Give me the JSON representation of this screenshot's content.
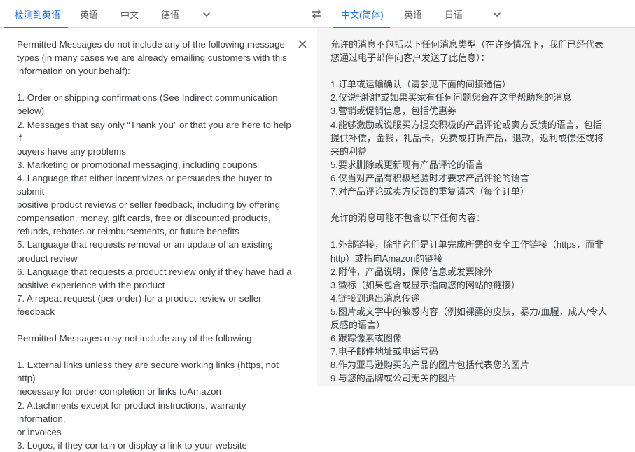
{
  "source_tabs": [
    {
      "label": "检测到英语",
      "active": true
    },
    {
      "label": "英语",
      "active": false
    },
    {
      "label": "中文",
      "active": false
    },
    {
      "label": "德语",
      "active": false
    }
  ],
  "target_tabs": [
    {
      "label": "中文(简体)",
      "active": true
    },
    {
      "label": "英语",
      "active": false
    },
    {
      "label": "日语",
      "active": false
    }
  ],
  "icons": {
    "source_more": "chevron-down-icon",
    "target_more": "chevron-down-icon",
    "swap": "swap-icon",
    "clear": "close-icon"
  },
  "colors": {
    "accent": "#1a73e8",
    "text": "#3c4043",
    "muted": "#5f6368",
    "output_bg": "#f5f5f5"
  },
  "source_text": "Permitted Messages do not include any of the following message\ntypes (in many cases we are already emailing customers with this\ninformation on your behalf):\n\n1. Order or shipping confirmations (See Indirect communication\nbelow)\n2. Messages that say only “Thank you” or that you are here to help if\nbuyers have any problems\n3. Marketing or promotional messaging, including coupons\n4. Language that either incentivizes or persuades the buyer to submit\npositive product reviews or seller feedback, including by offering\ncompensation, money, gift cards, free or discounted products,\nrefunds, rebates or reimbursements, or future benefits\n5. Language that requests removal or an update of an existing\nproduct review\n6. Language that requests a product review only if they have had a\npositive experience with the product\n7. A repeat request (per order) for a product review or seller feedback\n\nPermitted Messages may not include any of the following:\n\n1. External links unless they are secure working links (https, not http)\nnecessary for order completion or links toAmazon\n2. Attachments except for product instructions, warranty information,\nor invoices\n3. Logos, if they contain or display a link to your website",
  "translated_text": "允许的消息不包括以下任何消息类型（在许多情况下，我们已经代表\n您通过电子邮件向客户发送了此信息）：\n\n1.订单或运输确认（请参见下面的间接通信）\n2.仅说“谢谢”或如果买家有任何问题您会在这里帮助您的消息\n3.营销或促销信息，包括优惠券\n4.能够激励或说服买方提交积极的产品评论或卖方反馈的语言，包括\n提供补偿，金钱，礼品卡，免费或打折产品，退款，返利或偿还或将\n来的利益\n5.要求删除或更新现有产品评论的语言\n6.仅当对产品有积极经验时才要求产品评论的语言\n7.对产品评论或卖方反馈的重复请求（每个订单）\n\n允许的消息可能不包含以下任何内容：\n\n1.外部链接，除非它们是订单完成所需的安全工作链接（https，而非\nhttp）或指向Amazon的链接\n2.附件，产品说明，保修信息或发票除外\n3.徽标（如果包含或显示指向您的网站的链接）\n4.链接到退出消息传递\n5.图片或文字中的敏感内容（例如裸露的皮肤，暴力/血腥，成人/令人\n反感的语言）\n6.跟踪像素或图像\n7.电子邮件地址或电话号码\n8.作为亚马逊购买的产品的图片包括代表您的图片\n9.与您的品牌或公司无关的图片"
}
